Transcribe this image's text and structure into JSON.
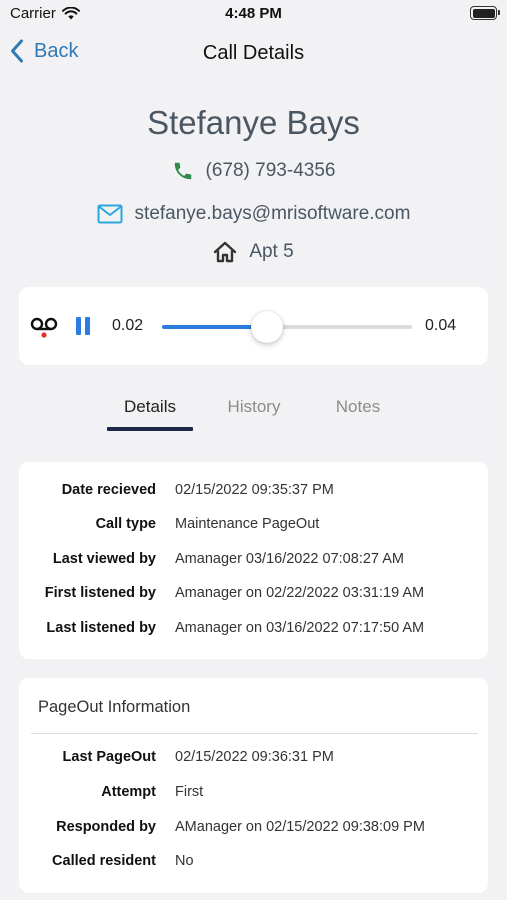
{
  "status_bar": {
    "carrier": "Carrier",
    "time": "4:48 PM"
  },
  "nav": {
    "back_label": "Back",
    "title": "Call Details"
  },
  "contact": {
    "name": "Stefanye Bays",
    "phone": "(678) 793-4356",
    "email": "stefanye.bays@mrisoftware.com",
    "unit": "Apt 5"
  },
  "player": {
    "current_time": "0.02",
    "total_time": "0.04",
    "progress": 0.42,
    "state": "playing"
  },
  "tabs": [
    {
      "label": "Details",
      "active": true
    },
    {
      "label": "History",
      "active": false
    },
    {
      "label": "Notes",
      "active": false
    }
  ],
  "details": [
    {
      "label": "Date recieved",
      "value": "02/15/2022 09:35:37 PM"
    },
    {
      "label": "Call type",
      "value": "Maintenance PageOut"
    },
    {
      "label": "Last viewed by",
      "value": "Amanager 03/16/2022 07:08:27 AM"
    },
    {
      "label": "First listened by",
      "value": "Amanager on 02/22/2022 03:31:19 AM"
    },
    {
      "label": "Last listened by",
      "value": "Amanager on 03/16/2022 07:17:50 AM"
    }
  ],
  "pageout": {
    "title": "PageOut Information",
    "rows": [
      {
        "label": "Last PageOut",
        "value": "02/15/2022 09:36:31 PM"
      },
      {
        "label": "Attempt",
        "value": "First"
      },
      {
        "label": "Responded by",
        "value": "AManager on 02/15/2022 09:38:09 PM"
      },
      {
        "label": "Called resident",
        "value": "No"
      }
    ]
  },
  "colors": {
    "accent": "#2b7de0",
    "back_link": "#2f7ab3",
    "phone_icon": "#2e8b4a",
    "email_icon": "#29a8e0",
    "tab_underline": "#1d2a4a",
    "voicemail_dot": "#e0302a"
  },
  "icons": {
    "signal": "wifi-icon",
    "back": "chevron-left-icon",
    "phone": "phone-icon",
    "email": "envelope-icon",
    "unit": "house-icon",
    "voicemail": "voicemail-icon",
    "pause": "pause-icon"
  }
}
